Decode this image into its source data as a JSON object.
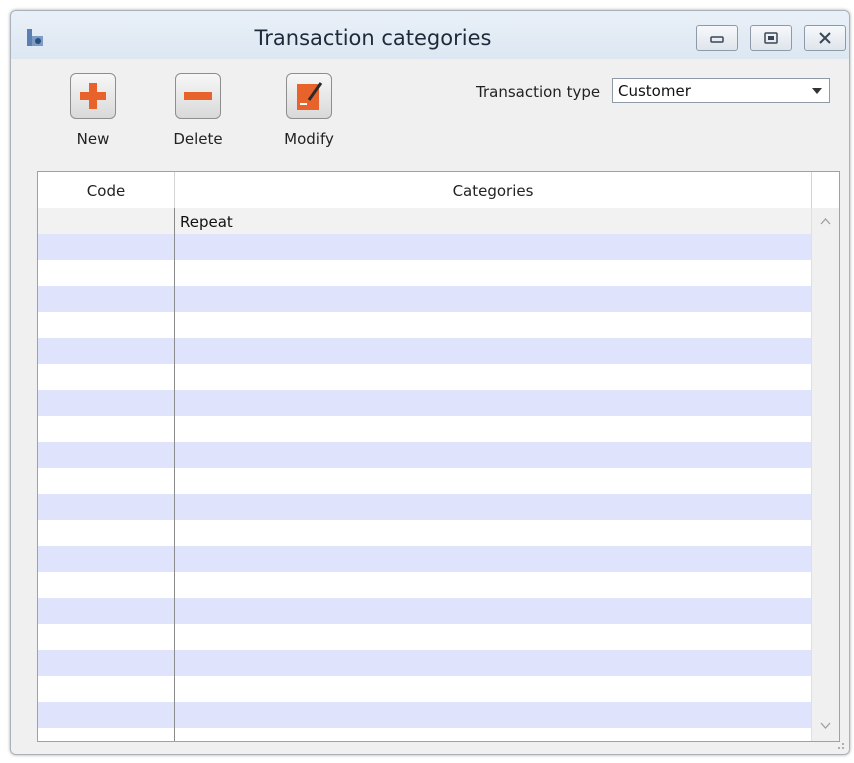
{
  "window": {
    "title": "Transaction categories",
    "icon": "app-icon",
    "controls": [
      "minimize-icon",
      "maximize-icon",
      "close-icon"
    ]
  },
  "toolbar": {
    "new_label": "New",
    "delete_label": "Delete",
    "modify_label": "Modify",
    "accent_color": "#e8622c"
  },
  "filter": {
    "label": "Transaction type",
    "value": "Customer"
  },
  "table": {
    "columns": [
      "Code",
      "Categories"
    ],
    "rows": [
      {
        "code": "",
        "category": "Repeat"
      }
    ],
    "stripe_color": "#dfe3fb"
  }
}
